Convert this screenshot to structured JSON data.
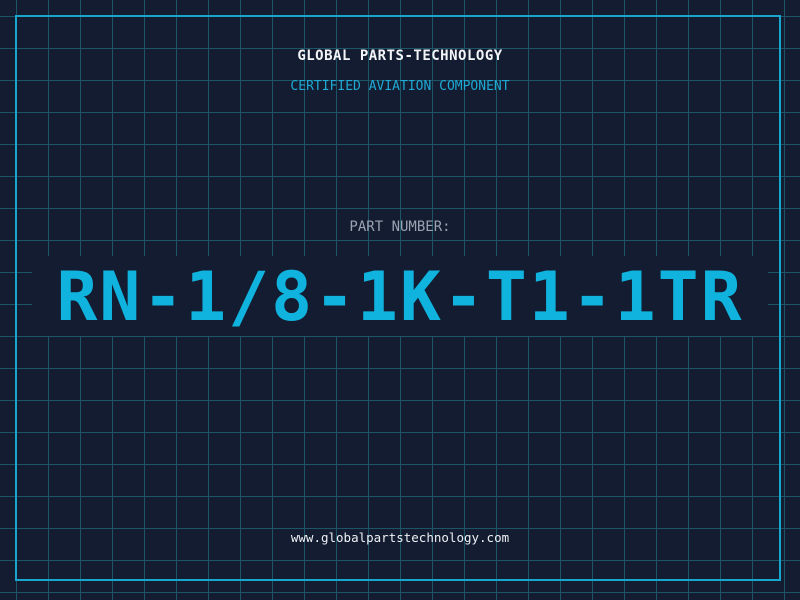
{
  "header": {
    "company_name": "GLOBAL PARTS-TECHNOLOGY",
    "subtitle": "CERTIFIED AVIATION COMPONENT"
  },
  "part": {
    "label": "PART NUMBER:",
    "number": "RN-1/8-1K-T1-1TR"
  },
  "footer": {
    "website": "www.globalpartstechnology.com"
  },
  "colors": {
    "background": "#131c30",
    "grid": "#1d5566",
    "frame": "#19a6cc",
    "accent": "#0fb3dd"
  }
}
